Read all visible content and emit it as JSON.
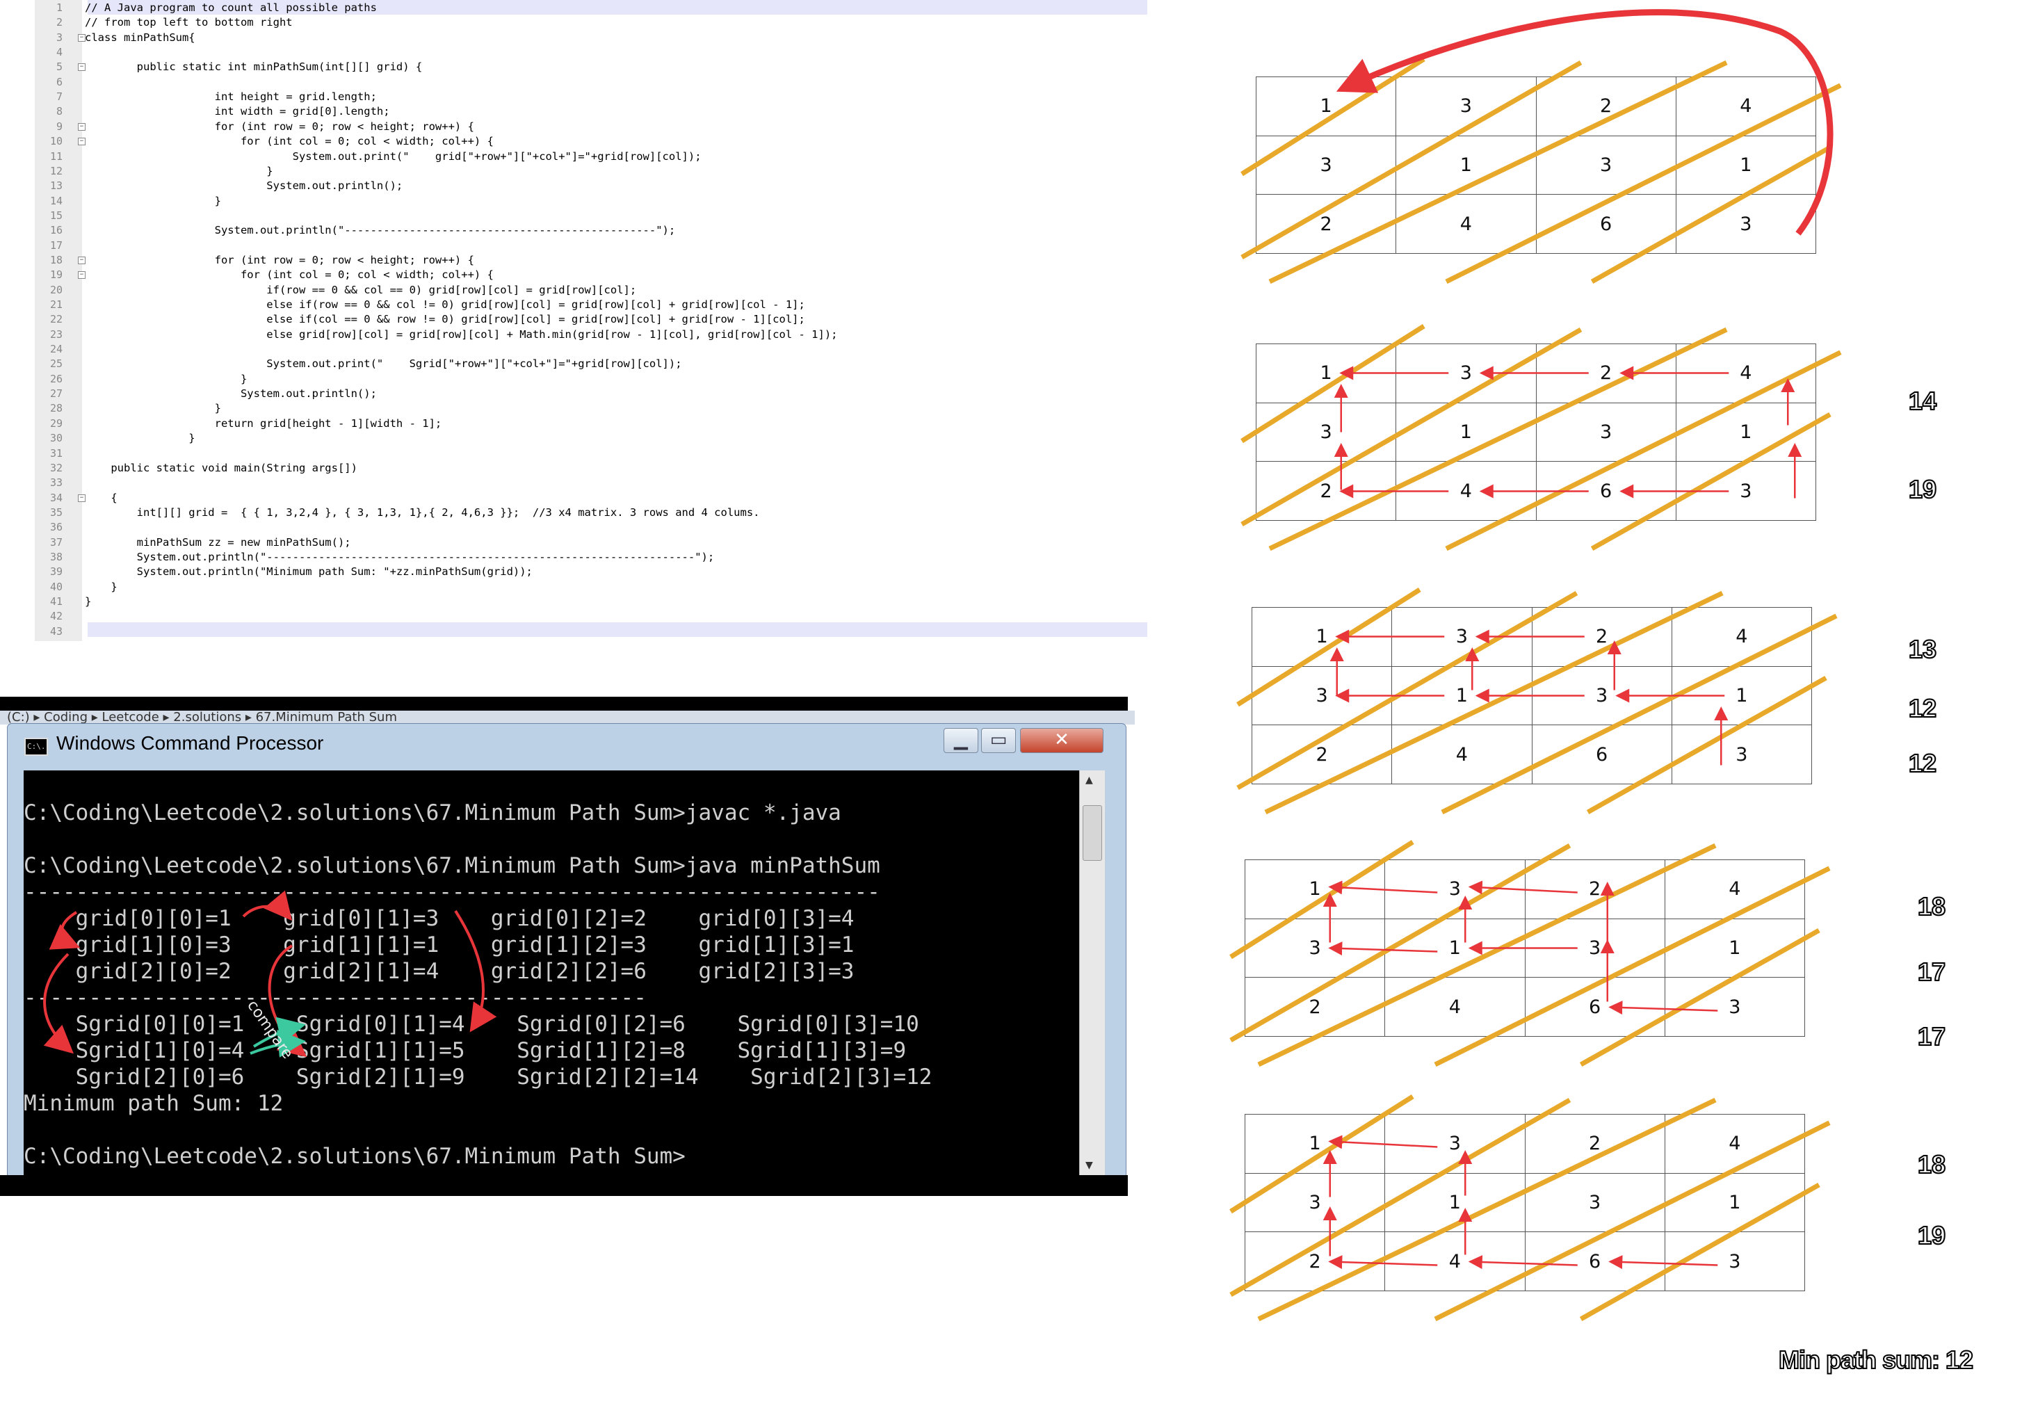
{
  "editor": {
    "line_numbers": [
      "1",
      "2",
      "3",
      "4",
      "5",
      "6",
      "7",
      "8",
      "9",
      "10",
      "11",
      "12",
      "13",
      "14",
      "15",
      "16",
      "17",
      "18",
      "19",
      "20",
      "21",
      "22",
      "23",
      "24",
      "25",
      "26",
      "27",
      "28",
      "29",
      "30",
      "31",
      "32",
      "33",
      "34",
      "35",
      "36",
      "37",
      "38",
      "39",
      "40",
      "41",
      "42",
      "43"
    ],
    "lines": [
      "// A Java program to count all possible paths",
      "// from top left to bottom right",
      "class minPathSum{",
      "",
      "        public static int minPathSum(int[][] grid) {",
      "",
      "                    int height = grid.length;",
      "                    int width = grid[0].length;",
      "                    for (int row = 0; row < height; row++) {",
      "                        for (int col = 0; col < width; col++) {",
      "                                System.out.print(\"    grid[\"+row+\"][\"+col+\"]=\"+grid[row][col]);",
      "                            }",
      "                            System.out.println();",
      "                    }",
      "",
      "                    System.out.println(\"------------------------------------------------\");",
      "",
      "                    for (int row = 0; row < height; row++) {",
      "                        for (int col = 0; col < width; col++) {",
      "                            if(row == 0 && col == 0) grid[row][col] = grid[row][col];",
      "                            else if(row == 0 && col != 0) grid[row][col] = grid[row][col] + grid[row][col - 1];",
      "                            else if(col == 0 && row != 0) grid[row][col] = grid[row][col] + grid[row - 1][col];",
      "                            else grid[row][col] = grid[row][col] + Math.min(grid[row - 1][col], grid[row][col - 1]);",
      "",
      "                            System.out.print(\"    Sgrid[\"+row+\"][\"+col+\"]=\"+grid[row][col]);",
      "                        }",
      "                        System.out.println();",
      "                    }",
      "                    return grid[height - 1][width - 1];",
      "                }",
      "",
      "    public static void main(String args[])",
      "",
      "    {",
      "        int[][] grid =  { { 1, 3,2,4 }, { 3, 1,3, 1},{ 2, 4,6,3 }};  //3 x4 matrix. 3 rows and 4 colums.",
      "",
      "        minPathSum zz = new minPathSum();",
      "        System.out.println(\"------------------------------------------------------------------\");",
      "        System.out.println(\"Minimum path Sum: \"+zz.minPathSum(grid));",
      "    }",
      "}",
      "",
      ""
    ]
  },
  "cmd": {
    "breadcrumb": "(C:) ▸ Coding ▸ Leetcode ▸ 2.solutions ▸ 67.Minimum Path Sum",
    "title": "Windows Command Processor",
    "icon_label": "C:\\.",
    "minimize_icon": "minimize-icon",
    "maximize_icon": "maximize-icon",
    "close_icon": "close-icon",
    "lines": [
      "C:\\Coding\\Leetcode\\2.solutions\\67.Minimum Path Sum>javac *.java",
      "",
      "C:\\Coding\\Leetcode\\2.solutions\\67.Minimum Path Sum>java minPathSum",
      "------------------------------------------------------------------",
      "    grid[0][0]=1    grid[0][1]=3    grid[0][2]=2    grid[0][3]=4",
      "    grid[1][0]=3    grid[1][1]=1    grid[1][2]=3    grid[1][3]=1",
      "    grid[2][0]=2    grid[2][1]=4    grid[2][2]=6    grid[2][3]=3",
      "------------------------------------------------",
      "    Sgrid[0][0]=1    Sgrid[0][1]=4    Sgrid[0][2]=6    Sgrid[0][3]=10",
      "    Sgrid[1][0]=4    Sgrid[1][1]=5    Sgrid[1][2]=8    Sgrid[1][3]=9",
      "    Sgrid[2][0]=6    Sgrid[2][1]=9    Sgrid[2][2]=14    Sgrid[2][3]=12",
      "Minimum path Sum: 12",
      "",
      "C:\\Coding\\Leetcode\\2.solutions\\67.Minimum Path Sum>"
    ],
    "annotation": "compare"
  },
  "diagrams": [
    {
      "cells": [
        [
          "1",
          "3",
          "2",
          "4"
        ],
        [
          "3",
          "1",
          "3",
          "1"
        ],
        [
          "2",
          "4",
          "6",
          "3"
        ]
      ],
      "side_values": []
    },
    {
      "cells": [
        [
          "1",
          "3",
          "2",
          "4"
        ],
        [
          "3",
          "1",
          "3",
          "1"
        ],
        [
          "2",
          "4",
          "6",
          "3"
        ]
      ],
      "side_values": [
        "14",
        "19"
      ]
    },
    {
      "cells": [
        [
          "1",
          "3",
          "2",
          "4"
        ],
        [
          "3",
          "1",
          "3",
          "1"
        ],
        [
          "2",
          "4",
          "6",
          "3"
        ]
      ],
      "side_values": [
        "13",
        "12",
        "12"
      ]
    },
    {
      "cells": [
        [
          "1",
          "3",
          "2",
          "4"
        ],
        [
          "3",
          "1",
          "3",
          "1"
        ],
        [
          "2",
          "4",
          "6",
          "3"
        ]
      ],
      "side_values": [
        "18",
        "17",
        "17"
      ]
    },
    {
      "cells": [
        [
          "1",
          "3",
          "2",
          "4"
        ],
        [
          "3",
          "1",
          "3",
          "1"
        ],
        [
          "2",
          "4",
          "6",
          "3"
        ]
      ],
      "side_values": [
        "18",
        "19"
      ]
    }
  ],
  "summary": {
    "label": "Min path sum:",
    "value": "12"
  },
  "colors": {
    "diagonal": "#e8a92a",
    "arrow": "#e8353a",
    "editor_highlight": "#e6e6fa"
  }
}
